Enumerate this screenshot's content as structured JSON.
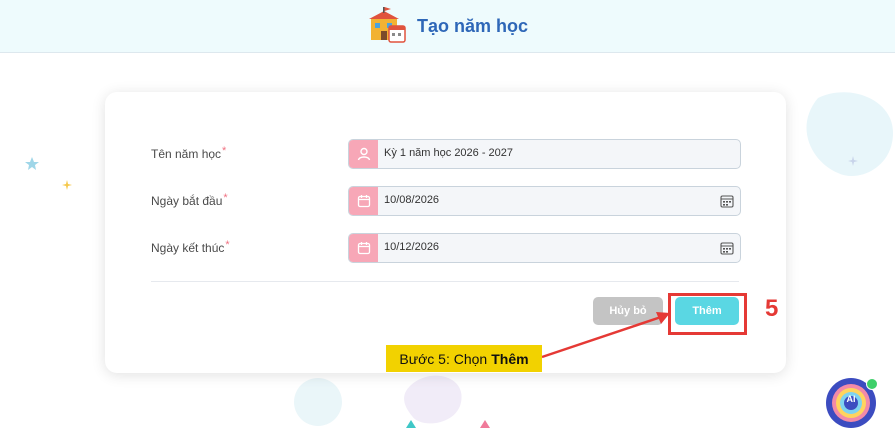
{
  "header": {
    "title": "Tạo năm học"
  },
  "form": {
    "name_label": "Tên năm học",
    "name_value": "Kỳ 1 năm học 2026 - 2027",
    "start_label": "Ngày bắt đầu",
    "start_value": "10/08/2026",
    "end_label": "Ngày kết thúc",
    "end_value": "10/12/2026",
    "required_mark": "*"
  },
  "actions": {
    "cancel_label": "Hủy bỏ",
    "add_label": "Thêm"
  },
  "annotation": {
    "step_number": "5",
    "caption_prefix": "Bước 5: Chọn",
    "caption_bold": "Thêm"
  },
  "ai_button": {
    "label": "AI"
  },
  "colors": {
    "accent": "#5ad7e3",
    "field_icon_bg": "#f7a7b7",
    "annotation_red": "#e53935",
    "caption_yellow": "#f2d200"
  }
}
